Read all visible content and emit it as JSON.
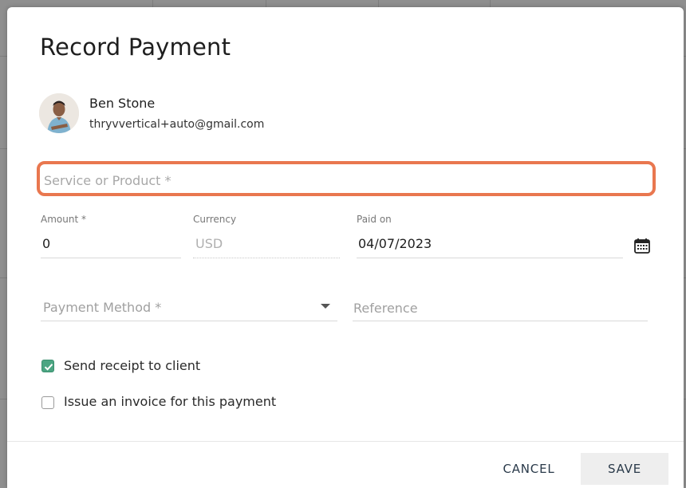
{
  "modal": {
    "title": "Record Payment"
  },
  "client": {
    "name": "Ben Stone",
    "email": "thryvvertical+auto@gmail.com"
  },
  "service": {
    "placeholder": "Service or Product *",
    "value": ""
  },
  "amount": {
    "label": "Amount *",
    "value": "0"
  },
  "currency": {
    "label": "Currency",
    "value": "USD"
  },
  "paid_on": {
    "label": "Paid on",
    "value": "04/07/2023"
  },
  "payment_method": {
    "placeholder": "Payment Method *"
  },
  "reference": {
    "placeholder": "Reference"
  },
  "options": {
    "send_receipt": {
      "label": "Send receipt to client",
      "checked": true
    },
    "issue_invoice": {
      "label": "Issue an invoice for this payment",
      "checked": false
    }
  },
  "buttons": {
    "cancel": "CANCEL",
    "save": "SAVE"
  },
  "colors": {
    "highlight": "#e9774f",
    "checkbox_checked": "#4ba582",
    "button_text": "#2a3a4a"
  },
  "icons": {
    "calendar": "calendar-icon",
    "dropdown": "chevron-down-icon",
    "check": "checkmark-icon"
  }
}
